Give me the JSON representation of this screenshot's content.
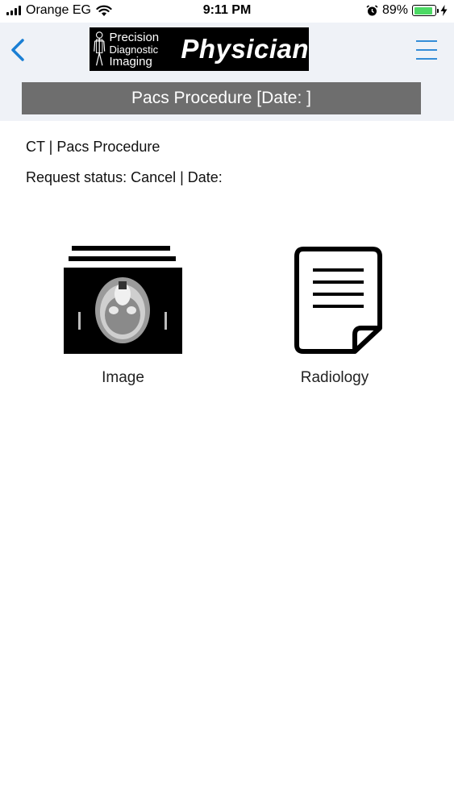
{
  "status_bar": {
    "carrier": "Orange EG",
    "time": "9:11 PM",
    "battery_percent": "89%",
    "battery_level": 0.89,
    "battery_color": "#4cd964",
    "icons": [
      "signal-icon",
      "wifi-icon",
      "alarm-icon",
      "battery-icon",
      "charging-icon"
    ]
  },
  "nav": {
    "back_icon": "chevron-left-icon",
    "menu_icon": "hamburger-menu-icon",
    "accent_color": "#1a7fd4",
    "logo": {
      "line1": "Precision",
      "line2": "Diagnostic",
      "line3": "Imaging",
      "title": "Physician"
    }
  },
  "header": {
    "title": "Pacs Procedure [Date: ]"
  },
  "procedure": {
    "line1": "CT | Pacs Procedure",
    "line2": "Request status: Cancel | Date:"
  },
  "tiles": [
    {
      "label": "Image",
      "icon": "ct-scan-image-icon"
    },
    {
      "label": "Radiology",
      "icon": "document-icon"
    }
  ]
}
